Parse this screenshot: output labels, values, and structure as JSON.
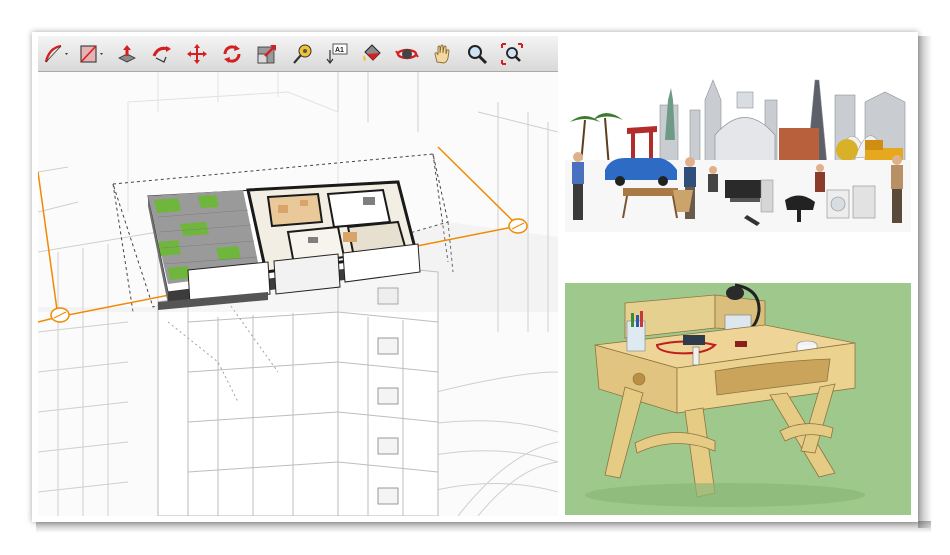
{
  "toolbar": {
    "tools": [
      {
        "icon": "line-tool-icon",
        "dropdown": true
      },
      {
        "icon": "rectangle-tool-icon",
        "dropdown": true
      },
      {
        "icon": "push-pull-icon"
      },
      {
        "icon": "follow-me-icon"
      },
      {
        "icon": "move-icon"
      },
      {
        "icon": "rotate-icon"
      },
      {
        "icon": "scale-icon"
      },
      {
        "icon": "tape-measure-icon"
      },
      {
        "icon": "text-tool-icon",
        "text": "A1"
      },
      {
        "icon": "paint-bucket-icon"
      },
      {
        "icon": "orbit-icon"
      },
      {
        "icon": "pan-hand-icon"
      },
      {
        "icon": "zoom-icon"
      },
      {
        "icon": "zoom-extents-icon"
      }
    ]
  },
  "colors": {
    "accent_orange": "#f08a00",
    "toolbar_red": "#d42020",
    "grass_green": "#6fb63c",
    "desk_background": "#9fc98c",
    "plywood": "#e8cf8a"
  }
}
